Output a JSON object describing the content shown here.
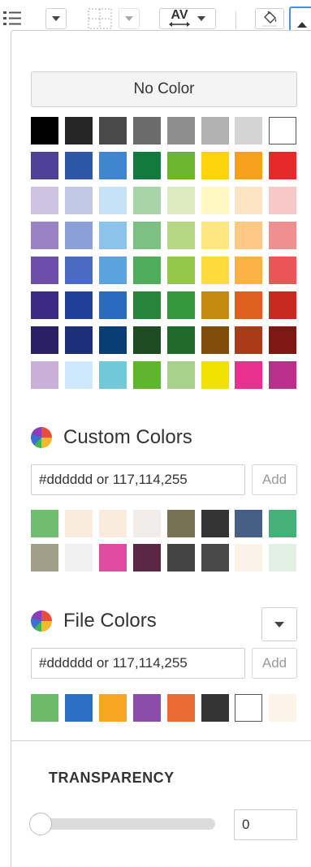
{
  "no_color_label": "No Color",
  "palette_rows": [
    [
      "#000000",
      "#262626",
      "#4a4a4a",
      "#6b6b6b",
      "#8e8e8e",
      "#b1b1b1",
      "#d4d4d4",
      "#ffffff"
    ],
    [
      "#4f4196",
      "#2e56a6",
      "#3e86cf",
      "#117a3c",
      "#6cb52e",
      "#ffd40a",
      "#f6a11e",
      "#e62a2a"
    ],
    [
      "#d0c3e2",
      "#c1c8e8",
      "#c6e2f6",
      "#a9d3a8",
      "#dcebbd",
      "#fff7c2",
      "#fde5c4",
      "#f8c8c8"
    ],
    [
      "#9a83c4",
      "#8c9fd6",
      "#8cc3ea",
      "#7dc083",
      "#b7d785",
      "#ffe780",
      "#fdc985",
      "#ef8f8f"
    ],
    [
      "#6d4ea8",
      "#4b6bc2",
      "#5aa2e0",
      "#4fac5a",
      "#94c84c",
      "#ffdc3c",
      "#fcb245",
      "#ea5656"
    ],
    [
      "#3b2a85",
      "#213e9a",
      "#2a6bbf",
      "#27843a",
      "#34993a",
      "#c48a0f",
      "#dd601f",
      "#c62a1f"
    ],
    [
      "#2b1f66",
      "#1e2f7a",
      "#083e73",
      "#1f4d23",
      "#1e6b2a",
      "#7f4c0a",
      "#aa3a1a",
      "#7f1812"
    ],
    [
      "#c8b0d8",
      "#cfe8fb",
      "#71c8d6",
      "#5eb52f",
      "#a8d28c",
      "#f1e200",
      "#e8318f",
      "#b8308a"
    ]
  ],
  "custom_colors": {
    "title": "Custom Colors",
    "input_value": "#dddddd or 117,114,255",
    "add_label": "Add",
    "swatches": [
      [
        "#6fbd6e",
        "#f9ebdd",
        "#f9ebdd",
        "#f0edea",
        "#787254",
        "#333333",
        "#465f84",
        "#46b07a"
      ],
      [
        "#a19e89",
        "#f0f0f0",
        "#e14aa1",
        "#5a2845",
        "#444444",
        "#484848",
        "#fbf3e7",
        "#e3f0e6"
      ]
    ]
  },
  "file_colors": {
    "title": "File Colors",
    "input_value": "#dddddd or 117,114,255",
    "add_label": "Add",
    "swatches": [
      "#6cbb69",
      "#2e6fc6",
      "#f9a722",
      "#8a4ea9",
      "#ec6b35",
      "#333333",
      "#ffffff",
      "#fcf4e9"
    ]
  },
  "transparency": {
    "label": "TRANSPARENCY",
    "value": "0",
    "slider_fraction": 0
  },
  "icons": {
    "list": "list-icon",
    "borders": "borders-icon",
    "character_spacing": "character-spacing-icon",
    "fill": "paint-bucket-icon",
    "collapse": "chevron-up-icon",
    "color_wheel": "color-wheel-icon",
    "dropdown": "chevron-down-icon"
  },
  "toolbar": {
    "spacing_label": "AV"
  }
}
